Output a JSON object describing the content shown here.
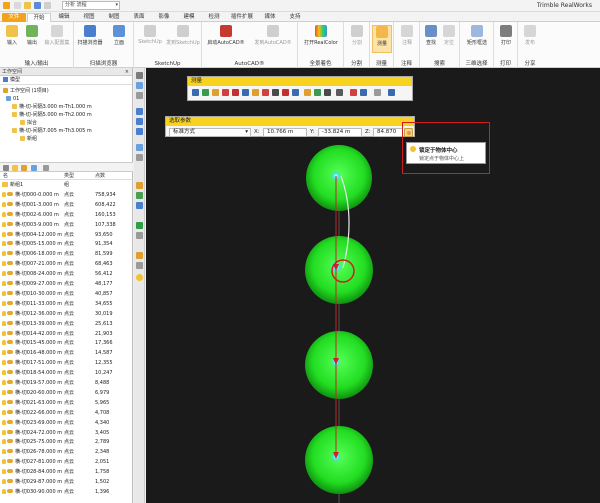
{
  "app": {
    "title": "Trimble RealWorks"
  },
  "quick": {
    "select_value": "分析 流程"
  },
  "tabs": [
    {
      "label": "文件"
    },
    {
      "label": "开始"
    },
    {
      "label": "编辑"
    },
    {
      "label": "视图"
    },
    {
      "label": "制图"
    },
    {
      "label": "表面"
    },
    {
      "label": "影像"
    },
    {
      "label": "建模"
    },
    {
      "label": "检测"
    },
    {
      "label": "插件扩展"
    },
    {
      "label": "媒体"
    },
    {
      "label": "支持"
    }
  ],
  "ribbon": {
    "groups": [
      {
        "label": "输入/输出"
      },
      {
        "label": "扫描浏览器"
      },
      {
        "label": "SketchUp"
      },
      {
        "label": "AutoCAD®"
      },
      {
        "label": "全景着色"
      },
      {
        "label": "分割"
      },
      {
        "label": "测量"
      },
      {
        "label": "注释"
      },
      {
        "label": "搜索"
      },
      {
        "label": "三维选择"
      },
      {
        "label": "打印"
      },
      {
        "label": "分享"
      }
    ],
    "buttons": {
      "import": "输入",
      "export": "输出",
      "import_config": "输入配置集",
      "scan_browser": "扫描浏览器",
      "views": "立面",
      "sketchup": "SketchUp",
      "send_sketchup": "发到SketchUp",
      "start_autocad": "启动AutoCAD®",
      "send_autocad": "发到AutoCAD®",
      "realcolor": "打开RealColor",
      "segment": "分割",
      "measure": "测量",
      "annotate": "注释",
      "find": "查找",
      "locate": "定位",
      "rect_select": "矩形框选",
      "print": "打印",
      "publish": "发布"
    }
  },
  "workspace": {
    "header": "工作空间",
    "model_tab": "模型",
    "project": "工作空间 (1项目)",
    "nodes": [
      {
        "label": "01"
      },
      {
        "label": "横-切-间隔3.000 m-Th1.000 m"
      },
      {
        "label": "横-切-间隔5.000 m-Th2.000 m"
      },
      {
        "label": "拟合"
      },
      {
        "label": "横-切-间隔7.005 m-Th3.005 m"
      },
      {
        "label": "新组"
      }
    ]
  },
  "list": {
    "headers": {
      "name": "名",
      "type": "类型",
      "points": "点数"
    },
    "rows": [
      {
        "name": "新组1",
        "type": "组",
        "points": "",
        "icon": "folder"
      },
      {
        "name": "横-切000-0.000 m",
        "type": "点云",
        "points": "758,934"
      },
      {
        "name": "横-切001-3.000 m",
        "type": "点云",
        "points": "608,422"
      },
      {
        "name": "横-切002-6.000 m",
        "type": "点云",
        "points": "160,153"
      },
      {
        "name": "横-切003-9.000 m",
        "type": "点云",
        "points": "107,338"
      },
      {
        "name": "横-切004-12.000 m",
        "type": "点云",
        "points": "93,650"
      },
      {
        "name": "横-切005-15.000 m",
        "type": "点云",
        "points": "91,354"
      },
      {
        "name": "横-切006-18.000 m",
        "type": "点云",
        "points": "81,599"
      },
      {
        "name": "横-切007-21.000 m",
        "type": "点云",
        "points": "68,463"
      },
      {
        "name": "横-切008-24.000 m",
        "type": "点云",
        "points": "56,412"
      },
      {
        "name": "横-切009-27.000 m",
        "type": "点云",
        "points": "48,177"
      },
      {
        "name": "横-切010-30.000 m",
        "type": "点云",
        "points": "40,857"
      },
      {
        "name": "横-切011-33.000 m",
        "type": "点云",
        "points": "34,655"
      },
      {
        "name": "横-切012-36.000 m",
        "type": "点云",
        "points": "30,019"
      },
      {
        "name": "横-切013-39.000 m",
        "type": "点云",
        "points": "25,613"
      },
      {
        "name": "横-切014-42.000 m",
        "type": "点云",
        "points": "21,903"
      },
      {
        "name": "横-切015-45.000 m",
        "type": "点云",
        "points": "17,366"
      },
      {
        "name": "横-切016-48.000 m",
        "type": "点云",
        "points": "14,587"
      },
      {
        "name": "横-切017-51.000 m",
        "type": "点云",
        "points": "12,355"
      },
      {
        "name": "横-切018-54.000 m",
        "type": "点云",
        "points": "10,247"
      },
      {
        "name": "横-切019-57.000 m",
        "type": "点云",
        "points": "8,488"
      },
      {
        "name": "横-切020-60.000 m",
        "type": "点云",
        "points": "6,979"
      },
      {
        "name": "横-切021-63.000 m",
        "type": "点云",
        "points": "5,965"
      },
      {
        "name": "横-切022-66.000 m",
        "type": "点云",
        "points": "4,708"
      },
      {
        "name": "横-切023-69.000 m",
        "type": "点云",
        "points": "4,340"
      },
      {
        "name": "横-切024-72.000 m",
        "type": "点云",
        "points": "3,405"
      },
      {
        "name": "横-切025-75.000 m",
        "type": "点云",
        "points": "2,789"
      },
      {
        "name": "横-切026-78.000 m",
        "type": "点云",
        "points": "2,348"
      },
      {
        "name": "横-切027-81.000 m",
        "type": "点云",
        "points": "2,051"
      },
      {
        "name": "横-切028-84.000 m",
        "type": "点云",
        "points": "1,758"
      },
      {
        "name": "横-切029-87.000 m",
        "type": "点云",
        "points": "1,502"
      },
      {
        "name": "横-切030-90.000 m",
        "type": "点云",
        "points": "1,396"
      }
    ]
  },
  "measure_toolbar": {
    "title": "测量"
  },
  "pick_panel": {
    "title": "选取参数",
    "mode": "标准方式",
    "x_label": "X:",
    "x_value": "10.766 m",
    "y_label": "Y:",
    "y_value": "-33.824 m",
    "z_label": "Z:",
    "z_value": "84.870 m"
  },
  "tooltip": {
    "title": "锁定于物体中心",
    "description": "锁定点于物体中心上"
  },
  "colors": {
    "accent": "#f2a31b",
    "sphere": "#22dd22",
    "highlight": "#d01e1e",
    "toolbar_header": "#f7d21f"
  }
}
